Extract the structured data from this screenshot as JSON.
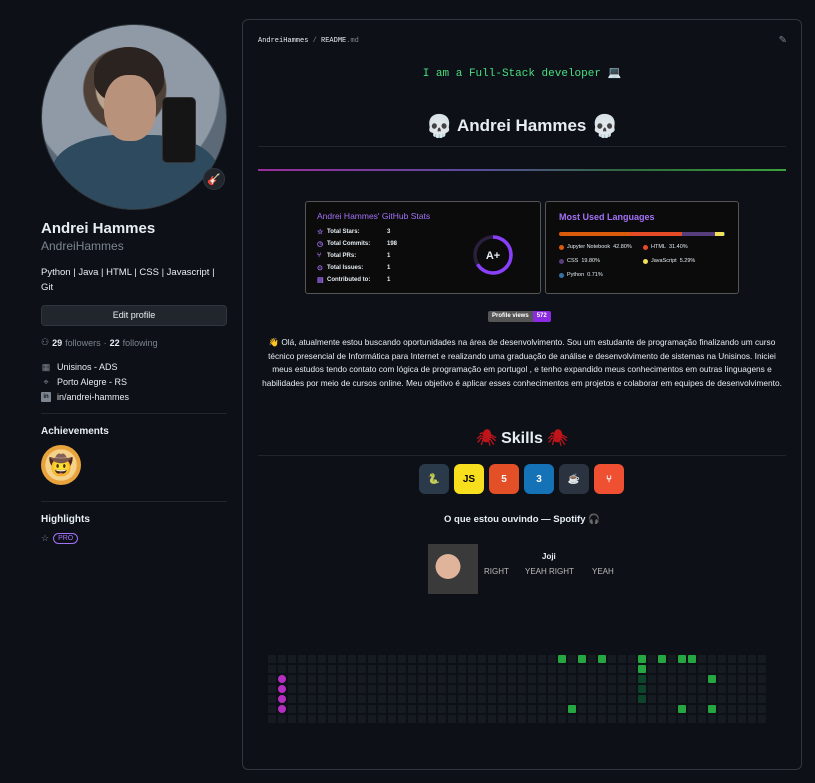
{
  "profile": {
    "name": "Andrei Hammes",
    "login": "AndreiHammes",
    "bio": "Python | Java | HTML | CSS | Javascript | Git",
    "edit_label": "Edit profile",
    "followers_count": "29",
    "followers_label": "followers",
    "separator": "·",
    "following_count": "22",
    "following_label": "following",
    "company": "Unisinos - ADS",
    "location": "Porto Alegre - RS",
    "linkedin": "in/andrei-hammes",
    "status_icon": "guitar-emoji"
  },
  "achievements": {
    "title": "Achievements",
    "badge": "🤠"
  },
  "highlights": {
    "title": "Highlights",
    "pro_label": "PRO"
  },
  "readme": {
    "path_owner": "AndreiHammes",
    "path_sep": " / ",
    "path_file": "README",
    "path_ext": ".md",
    "typing_text": "I am a Full-Stack developer 💻",
    "heading": "Andrei Hammes",
    "stats": {
      "title": "Andrei Hammes' GitHub Stats",
      "rows": [
        {
          "label": "Total Stars:",
          "value": "3"
        },
        {
          "label": "Total Commits:",
          "value": "198"
        },
        {
          "label": "Total PRs:",
          "value": "1"
        },
        {
          "label": "Total Issues:",
          "value": "1"
        },
        {
          "label": "Contributed to:",
          "value": "1"
        }
      ],
      "grade": "A+"
    },
    "languages": {
      "title": "Most Used Languages",
      "items": [
        {
          "name": "Jupyter Notebook",
          "pct": "42.80%",
          "color": "#DA5B0B",
          "value": 42.8
        },
        {
          "name": "HTML",
          "pct": "31.40%",
          "color": "#e34c26",
          "value": 31.4
        },
        {
          "name": "CSS",
          "pct": "19.80%",
          "color": "#563d7c",
          "value": 19.8
        },
        {
          "name": "JavaScript",
          "pct": "5.29%",
          "color": "#f1e05a",
          "value": 5.29
        },
        {
          "name": "Python",
          "pct": "0.71%",
          "color": "#3572A5",
          "value": 0.71
        }
      ]
    },
    "views": {
      "label": "Profile views",
      "count": "572"
    },
    "about": "👋 Olá, atualmente estou buscando oportunidades na área de desenvolvimento. Sou um estudante de programação finalizando um curso técnico presencial de Informática para Internet e realizando uma graduação de análise e desenvolvimento de sistemas na Unisinos. Iniciei meus estudos tendo contato com lógica de programação em portugol , e tenho expandido meus conhecimentos em outras linguagens e habilidades por meio de cursos online. Meu objetivo é aplicar esses conhecimentos em projetos e colaborar em equipes de desenvolvimento.",
    "skills_heading": "Skills",
    "skills": [
      {
        "name": "python-icon",
        "glyph": "🐍",
        "bg": "#2b3a4a",
        "fg": "#ffd43b"
      },
      {
        "name": "javascript-icon",
        "glyph": "JS",
        "bg": "#f7df1e",
        "fg": "#000000"
      },
      {
        "name": "html5-icon",
        "glyph": "5",
        "bg": "#e34f26",
        "fg": "#ffffff"
      },
      {
        "name": "css3-icon",
        "glyph": "3",
        "bg": "#1572b6",
        "fg": "#ffffff"
      },
      {
        "name": "java-icon",
        "glyph": "☕",
        "bg": "#2b3340",
        "fg": "#ffffff"
      },
      {
        "name": "git-icon",
        "glyph": "⑂",
        "bg": "#f05032",
        "fg": "#ffffff"
      }
    ],
    "spotify": {
      "title": "O que estou ouvindo — Spotify 🎧",
      "artist": "Joji",
      "tracks": [
        "RIGHT",
        "YEAH RIGHT",
        "YEAH"
      ]
    }
  }
}
